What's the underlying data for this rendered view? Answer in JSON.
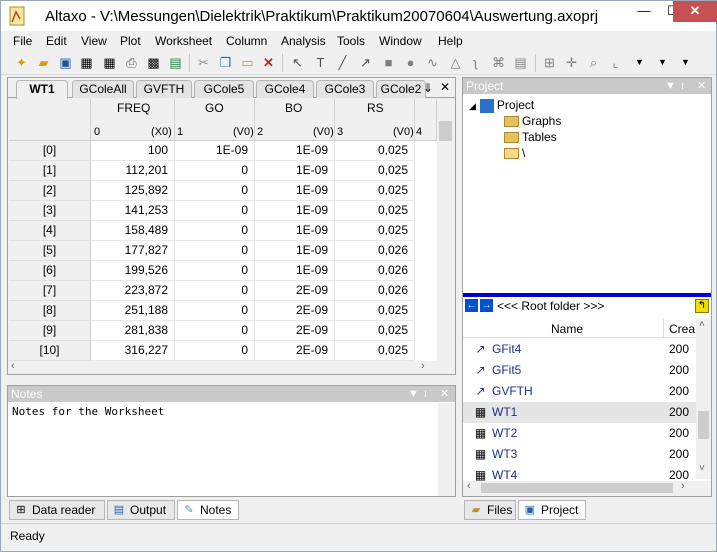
{
  "window": {
    "title": "Altaxo - V:\\Messungen\\Dielektrik\\Praktikum\\Praktikum20070604\\Auswertung.axoprj",
    "min_label": "—",
    "max_label": "☐",
    "close_label": "✕"
  },
  "menu": [
    "File",
    "Edit",
    "View",
    "Plot",
    "Worksheet",
    "Column",
    "Analysis",
    "Tools",
    "Window",
    "Help"
  ],
  "worksheet": {
    "tabs": [
      "WT1",
      "GColeAll",
      "GVFTH",
      "GCole5",
      "GCole4",
      "GCole3",
      "GCole2"
    ],
    "overflow_glyph": "⇓",
    "close_glyph": "✕",
    "columns": [
      {
        "name": "FREQ",
        "index": "0",
        "kind": "(X0)"
      },
      {
        "name": "GO",
        "index": "1",
        "kind": "(V0)"
      },
      {
        "name": "BO",
        "index": "2",
        "kind": "(V0)"
      },
      {
        "name": "RS",
        "index": "3",
        "kind": "(V0)"
      },
      {
        "name": "",
        "index": "4",
        "kind": ""
      }
    ],
    "rows": [
      {
        "label": "[0]",
        "freq": "100",
        "go": "1E-09",
        "bo": "1E-09",
        "rs": "0,025"
      },
      {
        "label": "[1]",
        "freq": "112,201",
        "go": "0",
        "bo": "1E-09",
        "rs": "0,025"
      },
      {
        "label": "[2]",
        "freq": "125,892",
        "go": "0",
        "bo": "1E-09",
        "rs": "0,025"
      },
      {
        "label": "[3]",
        "freq": "141,253",
        "go": "0",
        "bo": "1E-09",
        "rs": "0,025"
      },
      {
        "label": "[4]",
        "freq": "158,489",
        "go": "0",
        "bo": "1E-09",
        "rs": "0,025"
      },
      {
        "label": "[5]",
        "freq": "177,827",
        "go": "0",
        "bo": "1E-09",
        "rs": "0,026"
      },
      {
        "label": "[6]",
        "freq": "199,526",
        "go": "0",
        "bo": "1E-09",
        "rs": "0,026"
      },
      {
        "label": "[7]",
        "freq": "223,872",
        "go": "0",
        "bo": "2E-09",
        "rs": "0,026"
      },
      {
        "label": "[8]",
        "freq": "251,188",
        "go": "0",
        "bo": "2E-09",
        "rs": "0,025"
      },
      {
        "label": "[9]",
        "freq": "281,838",
        "go": "0",
        "bo": "2E-09",
        "rs": "0,025"
      },
      {
        "label": "[10]",
        "freq": "316,227",
        "go": "0",
        "bo": "2E-09",
        "rs": "0,025"
      }
    ]
  },
  "notes": {
    "title": "Notes",
    "text": "Notes for the Worksheet"
  },
  "bottom_tabs": [
    "Data reader",
    "Output",
    "Notes"
  ],
  "project": {
    "title": "Project",
    "tree_root": "Project",
    "tree_children": [
      "Graphs",
      "Tables",
      "\\"
    ],
    "root_folder_label": "<<< Root folder >>>",
    "list_headers": {
      "name": "Name",
      "created": "Crea"
    },
    "items": [
      {
        "name": "GFit4",
        "created": "200",
        "type": "graph"
      },
      {
        "name": "GFit5",
        "created": "200",
        "type": "graph"
      },
      {
        "name": "GVFTH",
        "created": "200",
        "type": "graph"
      },
      {
        "name": "WT1",
        "created": "200",
        "type": "table"
      },
      {
        "name": "WT2",
        "created": "200",
        "type": "table"
      },
      {
        "name": "WT3",
        "created": "200",
        "type": "table"
      },
      {
        "name": "WT4",
        "created": "200",
        "type": "table"
      }
    ],
    "bottom_tabs": [
      "Files",
      "Project"
    ]
  },
  "status": {
    "text": "Ready"
  }
}
